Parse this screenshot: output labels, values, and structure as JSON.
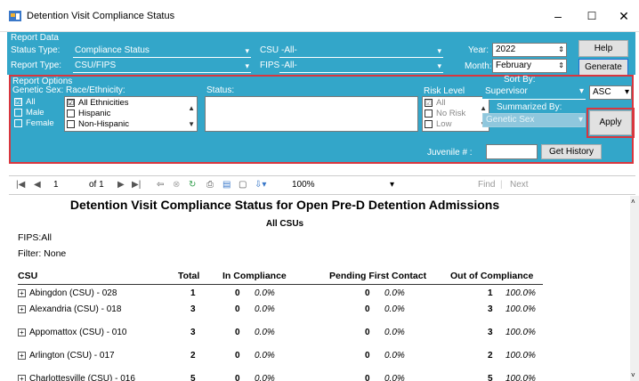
{
  "window": {
    "title": "Detention Visit Compliance Status",
    "min": "–",
    "max": "☐",
    "close": "✕"
  },
  "report_data": {
    "section_label": "Report Data",
    "status_type_label": "Status Type:",
    "status_type_value": "Compliance Status",
    "report_type_label": "Report Type:",
    "report_type_value": "CSU/FIPS",
    "csu_label": "CSU:",
    "csu_value": "-All-",
    "fips_label": "FIPS:",
    "fips_value": "-All-",
    "year_label": "Year:",
    "year_value": "2022",
    "month_label": "Month:",
    "month_value": "February",
    "help_label": "Help",
    "generate_label": "Generate"
  },
  "report_options": {
    "section_label": "Report Options",
    "genetic_sex_label": "Genetic Sex:",
    "genetic_sex_items": [
      {
        "label": "All",
        "checked": "☑"
      },
      {
        "label": "Male",
        "checked": ""
      },
      {
        "label": "Female",
        "checked": ""
      }
    ],
    "race_label": "Race/Ethnicity:",
    "race_items": [
      {
        "label": "All Ethnicities",
        "checked": "☑"
      },
      {
        "label": "Hispanic",
        "checked": ""
      },
      {
        "label": "Non-Hispanic",
        "checked": ""
      }
    ],
    "status_label": "Status:",
    "risk_label": "Risk Level",
    "risk_items": [
      {
        "label": "All",
        "checked": "☑"
      },
      {
        "label": "No Risk",
        "checked": ""
      },
      {
        "label": "Low",
        "checked": ""
      }
    ],
    "sort_by_label": "Sort By:",
    "sort_by_value": "Supervisor",
    "sort_dir_value": "ASC",
    "summarized_by_label": "Summarized By:",
    "summarized_by_value": "Genetic Sex",
    "apply_label": "Apply",
    "juvenile_label": "Juvenile # :",
    "juvenile_value": "",
    "get_history_label": "Get History"
  },
  "toolbar": {
    "page_current": "1",
    "page_of": "of 1",
    "zoom": "100%",
    "find_label": "Find",
    "next_label": "Next"
  },
  "report": {
    "title": "Detention Visit Compliance Status for Open Pre-D Detention Admissions",
    "subtitle": "All CSUs",
    "fips_line": "FIPS:All",
    "filter_line": "Filter: None",
    "headers": {
      "csu": "CSU",
      "total": "Total",
      "in_compliance": "In Compliance",
      "pending": "Pending First Contact",
      "out": "Out of Compliance"
    },
    "rows": [
      {
        "csu": "Abingdon (CSU) - 028",
        "total": "1",
        "in_n": "0",
        "in_p": "0.0%",
        "pend_n": "0",
        "pend_p": "0.0%",
        "out_n": "1",
        "out_p": "100.0%"
      },
      {
        "csu": "Alexandria (CSU) - 018",
        "total": "3",
        "in_n": "0",
        "in_p": "0.0%",
        "pend_n": "0",
        "pend_p": "0.0%",
        "out_n": "3",
        "out_p": "100.0%"
      },
      {
        "csu": "Appomattox (CSU) - 010",
        "total": "3",
        "in_n": "0",
        "in_p": "0.0%",
        "pend_n": "0",
        "pend_p": "0.0%",
        "out_n": "3",
        "out_p": "100.0%"
      },
      {
        "csu": "Arlington (CSU) - 017",
        "total": "2",
        "in_n": "0",
        "in_p": "0.0%",
        "pend_n": "0",
        "pend_p": "0.0%",
        "out_n": "2",
        "out_p": "100.0%"
      },
      {
        "csu": "Charlottesville (CSU) - 016",
        "total": "5",
        "in_n": "0",
        "in_p": "0.0%",
        "pend_n": "0",
        "pend_p": "0.0%",
        "out_n": "5",
        "out_p": "100.0%"
      }
    ]
  }
}
